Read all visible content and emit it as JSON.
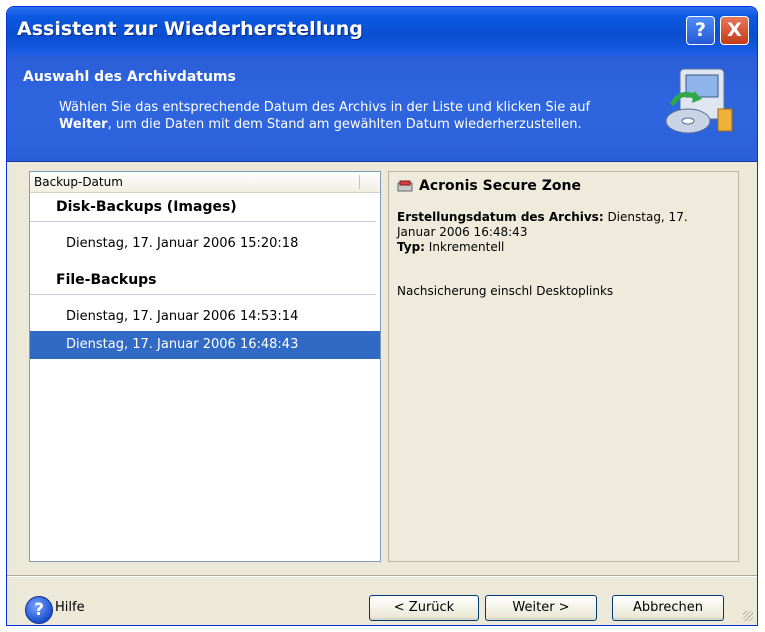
{
  "window": {
    "title": "Assistent zur Wiederherstellung"
  },
  "titlebar_buttons": {
    "help": "?",
    "close": "X"
  },
  "header": {
    "title": "Auswahl des Archivdatums",
    "desc_part1": "Wählen Sie das entsprechende Datum des Archivs in der Liste und klicken Sie auf",
    "desc_bold": "Weiter",
    "desc_part2": ", um die Daten mit dem Stand am gewählten Datum wiederherzustellen."
  },
  "list": {
    "column_header": "Backup-Datum",
    "groups": [
      {
        "label": "Disk-Backups (Images)",
        "items": [
          "Dienstag, 17. Januar 2006 15:20:18"
        ]
      },
      {
        "label": "File-Backups",
        "items": [
          "Dienstag, 17. Januar 2006 14:53:14",
          "Dienstag, 17. Januar 2006 16:48:43"
        ]
      }
    ],
    "selected": "Dienstag, 17. Januar 2006 16:48:43"
  },
  "details": {
    "title": "Acronis Secure Zone",
    "date_label": "Erstellungsdatum des Archivs:",
    "date_value": " Dienstag, 17. Januar 2006 16:48:43",
    "type_label": "Typ:",
    "type_value": " Inkrementell",
    "note": "Nachsicherung einschl Desktoplinks"
  },
  "footer": {
    "help": "Hilfe",
    "back": "< Zurück",
    "next": "Weiter >",
    "cancel": "Abbrechen"
  },
  "colors": {
    "titlebar": "#0a4ed0",
    "header": "#2f66df",
    "selection": "#316ac5",
    "dialog": "#ece9d8"
  }
}
